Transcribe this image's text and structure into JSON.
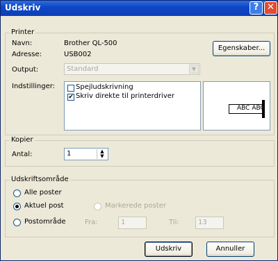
{
  "window": {
    "title": "Udskriv"
  },
  "printer": {
    "group_label": "Printer",
    "name_label": "Navn:",
    "name_value": "Brother QL-500",
    "address_label": "Adresse:",
    "address_value": "USB002",
    "properties_button": "Egenskaber...",
    "output_label": "Output:",
    "output_value": "Standard",
    "settings_label": "Indstillinger:",
    "settings_options": [
      {
        "label": "Spejludskrivning",
        "checked": false
      },
      {
        "label": "Skriv direkte til printerdriver",
        "checked": true
      }
    ],
    "preview_text": "ABC ABC"
  },
  "copies": {
    "group_label": "Kopier",
    "count_label": "Antal:",
    "count_value": "1"
  },
  "range": {
    "group_label": "Udskriftsområde",
    "all_label": "Alle poster",
    "current_label": "Aktuel post",
    "selected_label": "Markerede poster",
    "postrange_label": "Postområde",
    "from_label": "Fra:",
    "from_value": "1",
    "to_label": "Til:",
    "to_value": "13",
    "selected_option": "Aktuel post"
  },
  "buttons": {
    "print": "Udskriv",
    "cancel": "Annuller"
  }
}
